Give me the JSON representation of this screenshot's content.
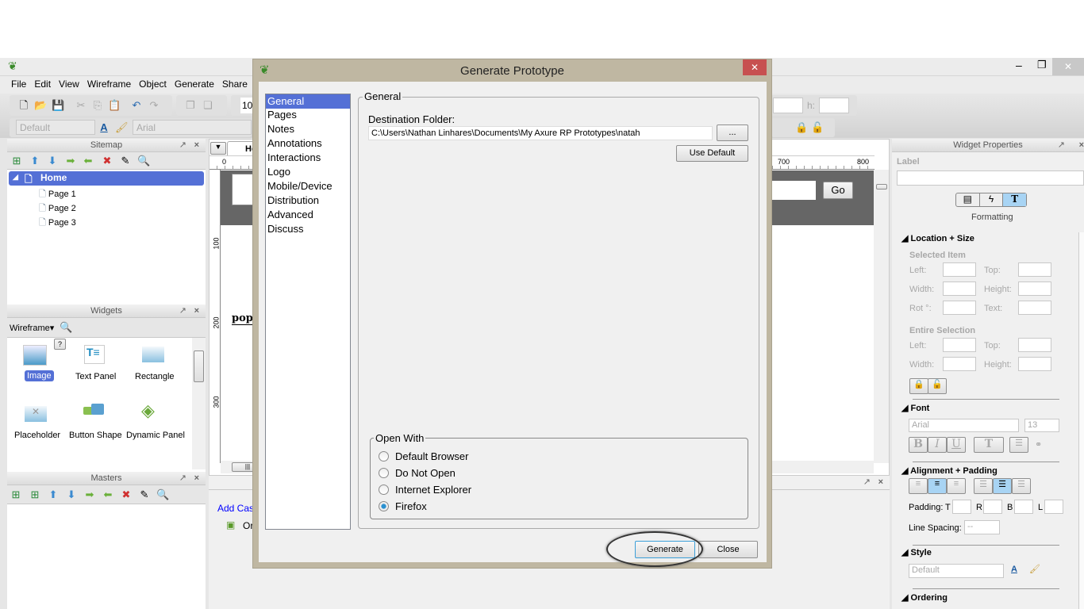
{
  "app": {
    "menu": [
      "File",
      "Edit",
      "View",
      "Wireframe",
      "Object",
      "Generate",
      "Share"
    ],
    "toolbar": {
      "zoom_partial": "10",
      "style_select": "Default",
      "font_select": "Arial",
      "h_label": "h:"
    },
    "window_controls": {
      "minimize": "–",
      "maximize": "❐",
      "close": "✕"
    }
  },
  "sitemap": {
    "title": "Sitemap",
    "items": [
      {
        "label": "Home",
        "selected": true
      },
      {
        "label": "Page 1"
      },
      {
        "label": "Page 2"
      },
      {
        "label": "Page 3"
      }
    ]
  },
  "widgets": {
    "title": "Widgets",
    "library": "Wireframe",
    "help": "?",
    "items": [
      {
        "label": "Image",
        "selected": true
      },
      {
        "label": "Text Panel"
      },
      {
        "label": "Rectangle"
      },
      {
        "label": "Placeholder"
      },
      {
        "label": "Button Shape"
      },
      {
        "label": "Dynamic Panel"
      }
    ]
  },
  "masters": {
    "title": "Masters"
  },
  "canvas": {
    "tab": "Ho",
    "ruler_top": [
      "0",
      "700",
      "800"
    ],
    "ruler_left": [
      "100",
      "200",
      "300"
    ],
    "go_button": "Go",
    "text_partial": "popu",
    "add_case": "Add Cas",
    "case_item": "Or"
  },
  "properties": {
    "title": "Widget Properties",
    "label_caption": "Label",
    "tab_caption": "Formatting",
    "location_size": {
      "title": "Location + Size",
      "selected_item": "Selected Item",
      "entire_selection": "Entire Selection",
      "left": "Left:",
      "top": "Top:",
      "width": "Width:",
      "height": "Height:",
      "rot": "Rot °:",
      "text": "Text:"
    },
    "font": {
      "title": "Font",
      "family": "Arial",
      "size": "13",
      "bold": "B",
      "italic": "I",
      "underline": "U",
      "color": "T"
    },
    "alignment": {
      "title": "Alignment + Padding",
      "padding": "Padding:",
      "t": "T",
      "r": "R",
      "b": "B",
      "l": "L",
      "line_spacing": "Line Spacing:",
      "line_spacing_value": "--"
    },
    "style": {
      "title": "Style",
      "value": "Default"
    },
    "ordering": {
      "title": "Ordering"
    }
  },
  "dialog": {
    "title": "Generate Prototype",
    "close": "✕",
    "nav": [
      {
        "label": "General",
        "selected": true
      },
      {
        "label": "Pages"
      },
      {
        "label": "Notes"
      },
      {
        "label": "Annotations"
      },
      {
        "label": "Interactions"
      },
      {
        "label": "Logo"
      },
      {
        "label": "Mobile/Device"
      },
      {
        "label": "Distribution"
      },
      {
        "label": "Advanced"
      },
      {
        "label": "Discuss"
      }
    ],
    "group_title": "General",
    "dest_label": "Destination Folder:",
    "dest_value": "C:\\Users\\Nathan Linhares\\Documents\\My Axure RP Prototypes\\natah",
    "browse": "...",
    "use_default": "Use Default",
    "open_with": {
      "title": "Open With",
      "options": [
        {
          "label": "Default Browser",
          "checked": false
        },
        {
          "label": "Do Not Open",
          "checked": false
        },
        {
          "label": "Internet Explorer",
          "checked": false
        },
        {
          "label": "Firefox",
          "checked": true
        }
      ]
    },
    "generate": "Generate",
    "close_button": "Close"
  },
  "colors": {
    "selection": "#5470d6",
    "dialog_frame": "#bfb7a2",
    "close_red": "#c75050",
    "link": "#0000ff"
  }
}
